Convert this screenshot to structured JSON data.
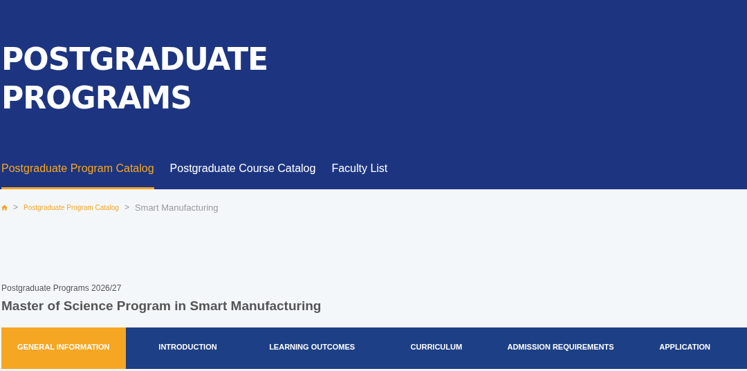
{
  "header": {
    "title_lines": [
      "POSTGRADUATE",
      "PROGRAMS"
    ]
  },
  "nav_tabs": [
    {
      "label": "Postgraduate Program Catalog",
      "selected": true
    },
    {
      "label": "Postgraduate Course Catalog",
      "selected": false
    },
    {
      "label": "Faculty List",
      "selected": false
    }
  ],
  "breadcrumb": [
    {
      "label": "Postgraduate Program Catalog",
      "kind": "link"
    },
    {
      "label": "Smart Manufacturing",
      "kind": "current"
    }
  ],
  "breadcrumb_separators": [
    ">",
    ">"
  ],
  "program": {
    "subtitle": "Postgraduate Programs 2026/27",
    "title": "Master of Science Program in Smart Manufacturing"
  },
  "section_tabs": [
    {
      "label": "GENERAL INFORMATION",
      "selected": true
    },
    {
      "label": "INTRODUCTION",
      "selected": false
    },
    {
      "label": "LEARNING OUTCOMES",
      "selected": false
    },
    {
      "label": "CURRICULUM",
      "selected": false
    },
    {
      "label": "ADMISSION REQUIREMENTS",
      "selected": false
    },
    {
      "label": "APPLICATION",
      "selected": false
    }
  ]
}
